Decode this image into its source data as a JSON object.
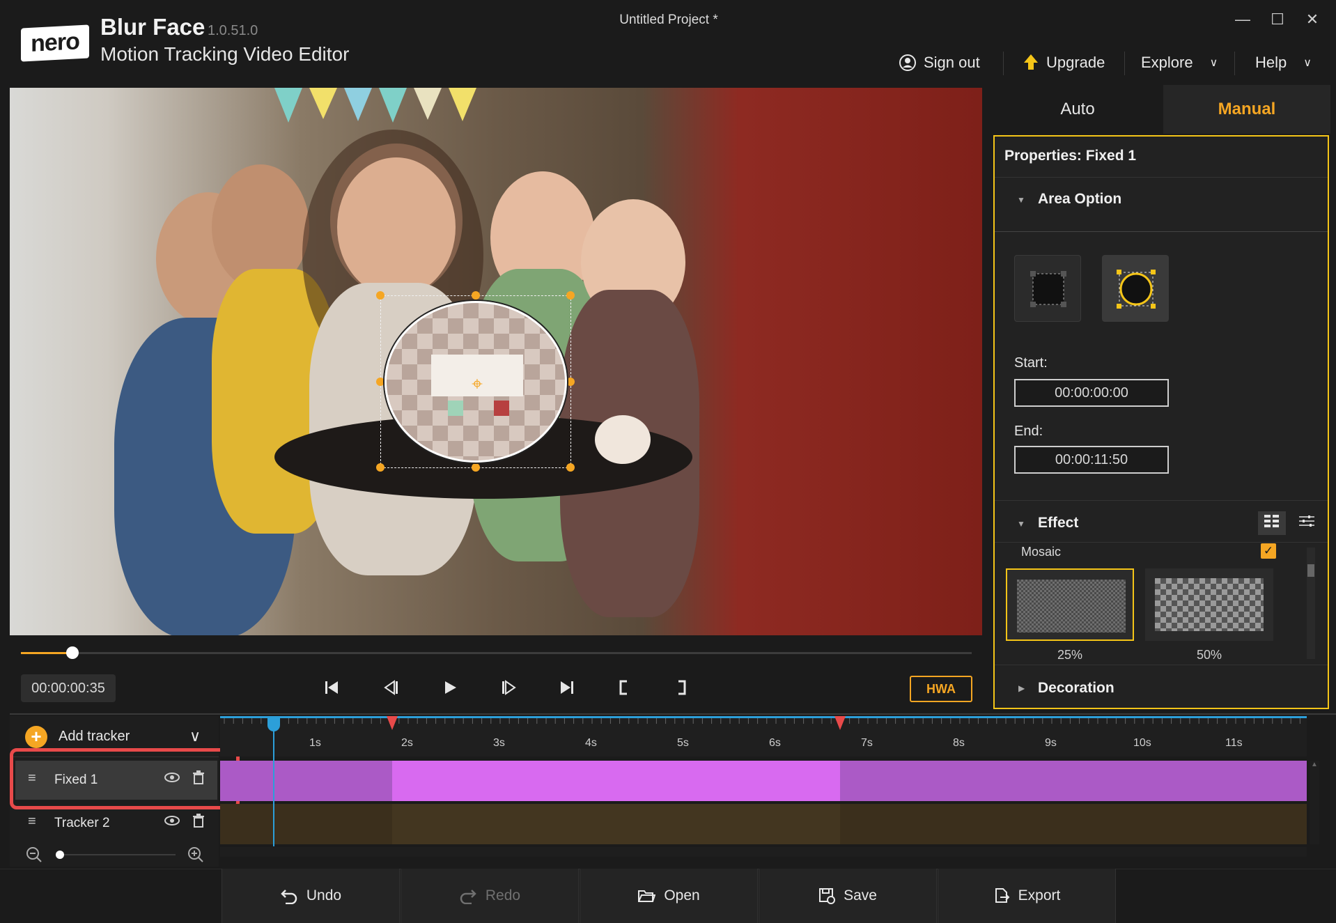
{
  "app": {
    "logo": "nero",
    "name": "Blur Face",
    "version": "1.0.51.0",
    "subtitle": "Motion Tracking Video Editor",
    "project_title": "Untitled Project *"
  },
  "window_controls": {
    "minimize": "—",
    "maximize": "☐",
    "close": "✕"
  },
  "topnav": {
    "sign_out": "Sign out",
    "upgrade": "Upgrade",
    "explore": "Explore",
    "help": "Help"
  },
  "player": {
    "timecode": "00:00:00:35",
    "hwa": "HWA",
    "progress": 0.05
  },
  "tabs": {
    "auto": "Auto",
    "manual": "Manual",
    "active": "Manual"
  },
  "properties": {
    "title": "Properties:  Fixed 1",
    "area_option": "Area Option",
    "area_shape_selected": "ellipse",
    "start_label": "Start:",
    "start_value": "00:00:00:00",
    "end_label": "End:",
    "end_value": "00:00:11:50",
    "effect": "Effect",
    "effect_name": "Mosaic",
    "effect_enabled": true,
    "mosaic_options": [
      {
        "label": "25%",
        "selected": true
      },
      {
        "label": "50%",
        "selected": false
      }
    ],
    "decoration": "Decoration"
  },
  "timeline": {
    "add_tracker": "Add tracker",
    "ticks": [
      "1s",
      "2s",
      "3s",
      "4s",
      "5s",
      "6s",
      "7s",
      "8s",
      "9s",
      "10s",
      "11s"
    ],
    "tracks": [
      {
        "name": "Fixed 1",
        "selected": true
      },
      {
        "name": "Tracker 2",
        "selected": false
      }
    ]
  },
  "toolbar": {
    "undo": "Undo",
    "redo": "Redo",
    "open": "Open",
    "save": "Save",
    "export": "Export"
  },
  "colors": {
    "accent": "#f5a623",
    "clip": "#d86af0",
    "playhead": "#2c9fd9",
    "highlight": "#e84a4a"
  }
}
